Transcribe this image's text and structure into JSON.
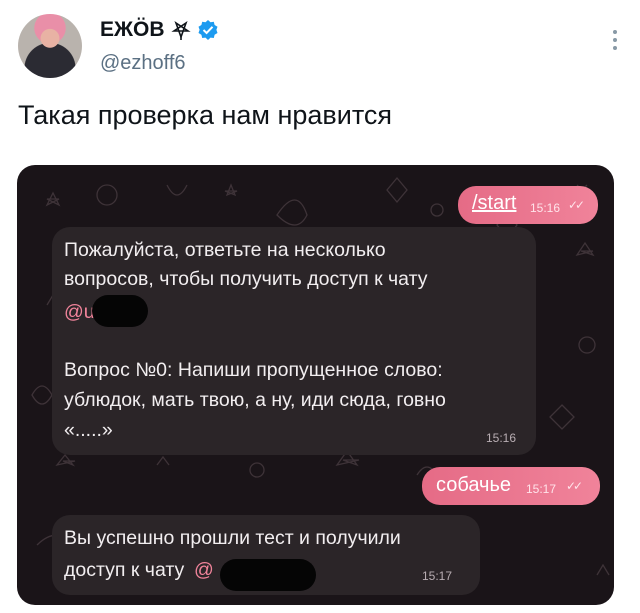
{
  "author": {
    "display_name": "ЕЖÖВ",
    "handle": "@ezhoff6",
    "badge_icon": "verified-icon",
    "name_icon": "pentagram-icon",
    "avatar_icon": "avatar"
  },
  "tweet": {
    "text": "Такая проверка нам нравится"
  },
  "chat": {
    "messages": [
      {
        "direction": "out",
        "text": "/start",
        "time": "15:16",
        "status_icon": "double-check-icon"
      },
      {
        "direction": "in",
        "lines": [
          "Пожалуйста, ответьте на несколько",
          "вопросов, чтобы получить доступ к чату"
        ],
        "mention": "@u",
        "question_lines": [
          "Вопрос №0: Напиши пропущенное слово:",
          "ублюдок, мать твою, а ну, иди сюда, говно",
          "«.....»"
        ],
        "time": "15:16"
      },
      {
        "direction": "out",
        "text": "собачье",
        "time": "15:17",
        "status_icon": "double-check-icon"
      },
      {
        "direction": "in",
        "lines": [
          "Вы успешно прошли тест и получили",
          "доступ к чату"
        ],
        "mention": "@",
        "time": "15:17"
      }
    ]
  },
  "colors": {
    "outgoing_bubble": "#ec7690",
    "incoming_bubble": "#2b2528",
    "chat_background": "#1a1418",
    "verified": "#1d9bf0"
  }
}
